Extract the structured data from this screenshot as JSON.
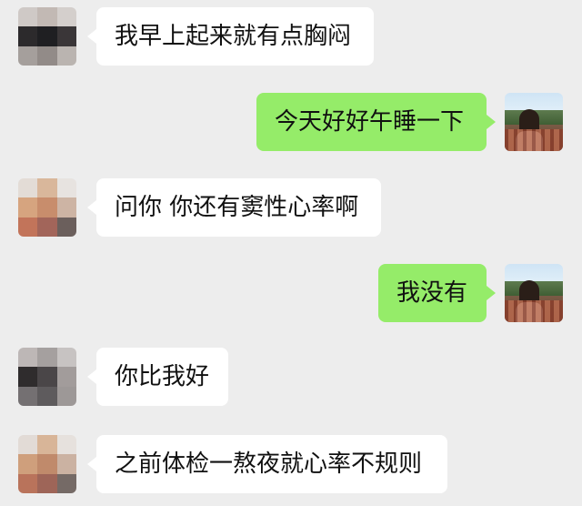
{
  "colors": {
    "background": "#ededed",
    "incoming_bubble": "#ffffff",
    "outgoing_bubble": "#95ec69",
    "text": "#111111"
  },
  "messages": [
    {
      "side": "left",
      "text": "我早上起来就有点胸闷",
      "avatar": "pixelated-avatar"
    },
    {
      "side": "right",
      "text": "今天好好午睡一下",
      "avatar": "photo-avatar"
    },
    {
      "side": "left",
      "text": "问你 你还有窦性心率啊",
      "avatar": "pixelated-avatar"
    },
    {
      "side": "right",
      "text": "我没有",
      "avatar": "photo-avatar"
    },
    {
      "side": "left",
      "text": "你比我好",
      "avatar": "pixelated-avatar"
    },
    {
      "side": "left",
      "text": "之前体检一熬夜就心率不规则",
      "avatar": "pixelated-avatar"
    }
  ]
}
